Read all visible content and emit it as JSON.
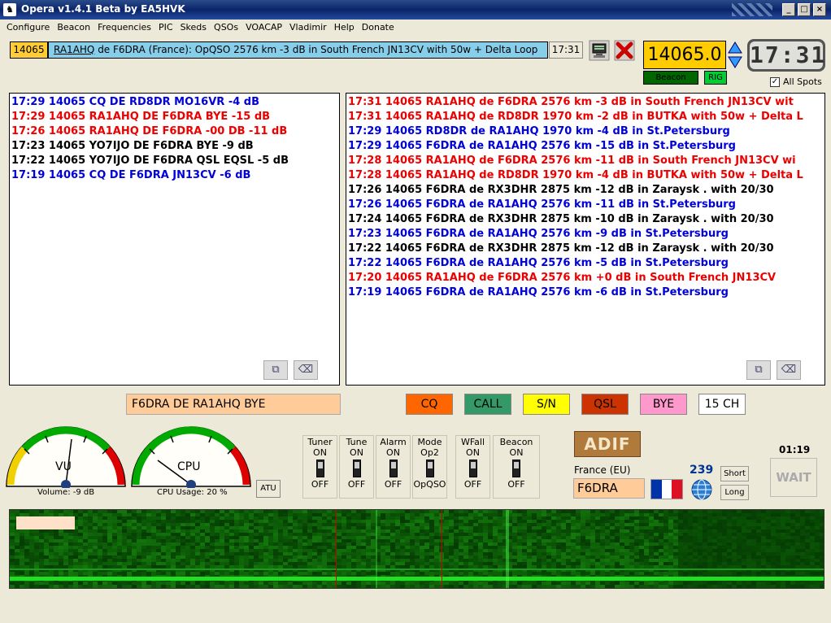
{
  "window": {
    "title": "Opera v1.4.1 Beta   by EA5HVK"
  },
  "menu": [
    "Configure",
    "Beacon",
    "Frequencies",
    "PIC",
    "Skeds",
    "QSOs",
    "VOACAP",
    "Vladimir",
    "Help",
    "Donate"
  ],
  "top": {
    "freq": "14065",
    "message_call": "RA1AHQ",
    "message_rest": " de F6DRA (France): OpQSO 2576 km -3 dB in South French  JN13CV with 50w + Delta Loop",
    "time": "17:31",
    "big_freq": "14065.0",
    "beacon_label": "Beacon",
    "rig_label": "RIG",
    "clock": "17:31",
    "all_spots_label": "All Spots"
  },
  "left_list": [
    {
      "text": "17:29 14065 CQ DE RD8DR MO16VR -4 dB",
      "color": "blue"
    },
    {
      "text": "17:29 14065 RA1AHQ DE F6DRA BYE -15 dB",
      "color": "red"
    },
    {
      "text": "17:26 14065 RA1AHQ DE F6DRA -00 DB -11 dB",
      "color": "red"
    },
    {
      "text": "17:23 14065 YO7IJO DE F6DRA BYE -9 dB",
      "color": "black"
    },
    {
      "text": "17:22 14065 YO7IJO DE F6DRA QSL EQSL -5 dB",
      "color": "black"
    },
    {
      "text": "17:19 14065 CQ DE F6DRA JN13CV -6 dB",
      "color": "blue"
    }
  ],
  "right_list": [
    {
      "text": "17:31 14065 RA1AHQ de F6DRA 2576 km -3 dB in South French  JN13CV wit",
      "color": "red"
    },
    {
      "text": "17:31 14065 RA1AHQ de RD8DR 1970 km -2 dB in BUTKA with 50w + Delta L",
      "color": "red"
    },
    {
      "text": "17:29 14065 RD8DR de RA1AHQ 1970 km -4 dB in St.Petersburg",
      "color": "blue"
    },
    {
      "text": "17:29 14065 F6DRA de RA1AHQ 2576 km -15 dB in St.Petersburg",
      "color": "blue"
    },
    {
      "text": "17:28 14065 RA1AHQ de F6DRA 2576 km -11 dB in South French  JN13CV wi",
      "color": "red"
    },
    {
      "text": "17:28 14065 RA1AHQ de RD8DR 1970 km -4 dB in BUTKA with 50w + Delta L",
      "color": "red"
    },
    {
      "text": "17:26 14065 F6DRA de RX3DHR 2875 km -12 dB in Zaraysk    . with 20/30",
      "color": "black"
    },
    {
      "text": "17:26 14065 F6DRA de RA1AHQ 2576 km -11 dB in St.Petersburg",
      "color": "blue"
    },
    {
      "text": "17:24 14065 F6DRA de RX3DHR 2875 km -10 dB in Zaraysk    . with 20/30",
      "color": "black"
    },
    {
      "text": "17:23 14065 F6DRA de RA1AHQ 2576 km -9 dB in St.Petersburg",
      "color": "blue"
    },
    {
      "text": "17:22 14065 F6DRA de RX3DHR 2875 km -12 dB in Zaraysk    . with 20/30",
      "color": "black"
    },
    {
      "text": "17:22 14065 F6DRA de RA1AHQ 2576 km -5 dB in St.Petersburg",
      "color": "blue"
    },
    {
      "text": "17:20 14065 RA1AHQ de F6DRA 2576 km +0 dB in South French  JN13CV",
      "color": "red"
    },
    {
      "text": "17:19 14065 F6DRA de RA1AHQ 2576 km -6 dB in St.Petersburg",
      "color": "blue"
    }
  ],
  "reply": "F6DRA DE RA1AHQ BYE",
  "macros": [
    {
      "label": "CQ",
      "bg": "#ff6600"
    },
    {
      "label": "CALL",
      "bg": "#339966"
    },
    {
      "label": "S/N",
      "bg": "#ffff00"
    },
    {
      "label": "QSL",
      "bg": "#cc3300"
    },
    {
      "label": "BYE",
      "bg": "#ff99cc"
    },
    {
      "label": "15 CH",
      "bg": "#ffffff"
    }
  ],
  "gauges": {
    "vu_label": "VU",
    "vu_caption": "Volume: -9 dB",
    "cpu_label": "CPU",
    "cpu_caption": "CPU Usage: 20 %",
    "atu": "ATU"
  },
  "switches": [
    {
      "title": "Tuner",
      "on": "ON",
      "off": "OFF"
    },
    {
      "title": "Tune",
      "on": "ON",
      "off": "OFF"
    },
    {
      "title": "Alarm",
      "on": "ON",
      "off": "OFF"
    },
    {
      "title": "Mode",
      "on": "Op2",
      "off": "OpQSO"
    },
    {
      "title": "WFall",
      "on": "ON",
      "off": "OFF"
    },
    {
      "title": "Beacon",
      "on": "ON",
      "off": "OFF"
    }
  ],
  "station": {
    "adif": "ADIF",
    "country": "France (EU)",
    "call": "F6DRA",
    "bearing": "239",
    "short": "Short",
    "long": "Long",
    "timer": "01:19",
    "wait": "WAIT"
  },
  "colors": {
    "list_blue": "#0000dd",
    "list_red": "#ee0000",
    "waterfall_bg": "#0a2a08",
    "marker": "#cc0000"
  }
}
